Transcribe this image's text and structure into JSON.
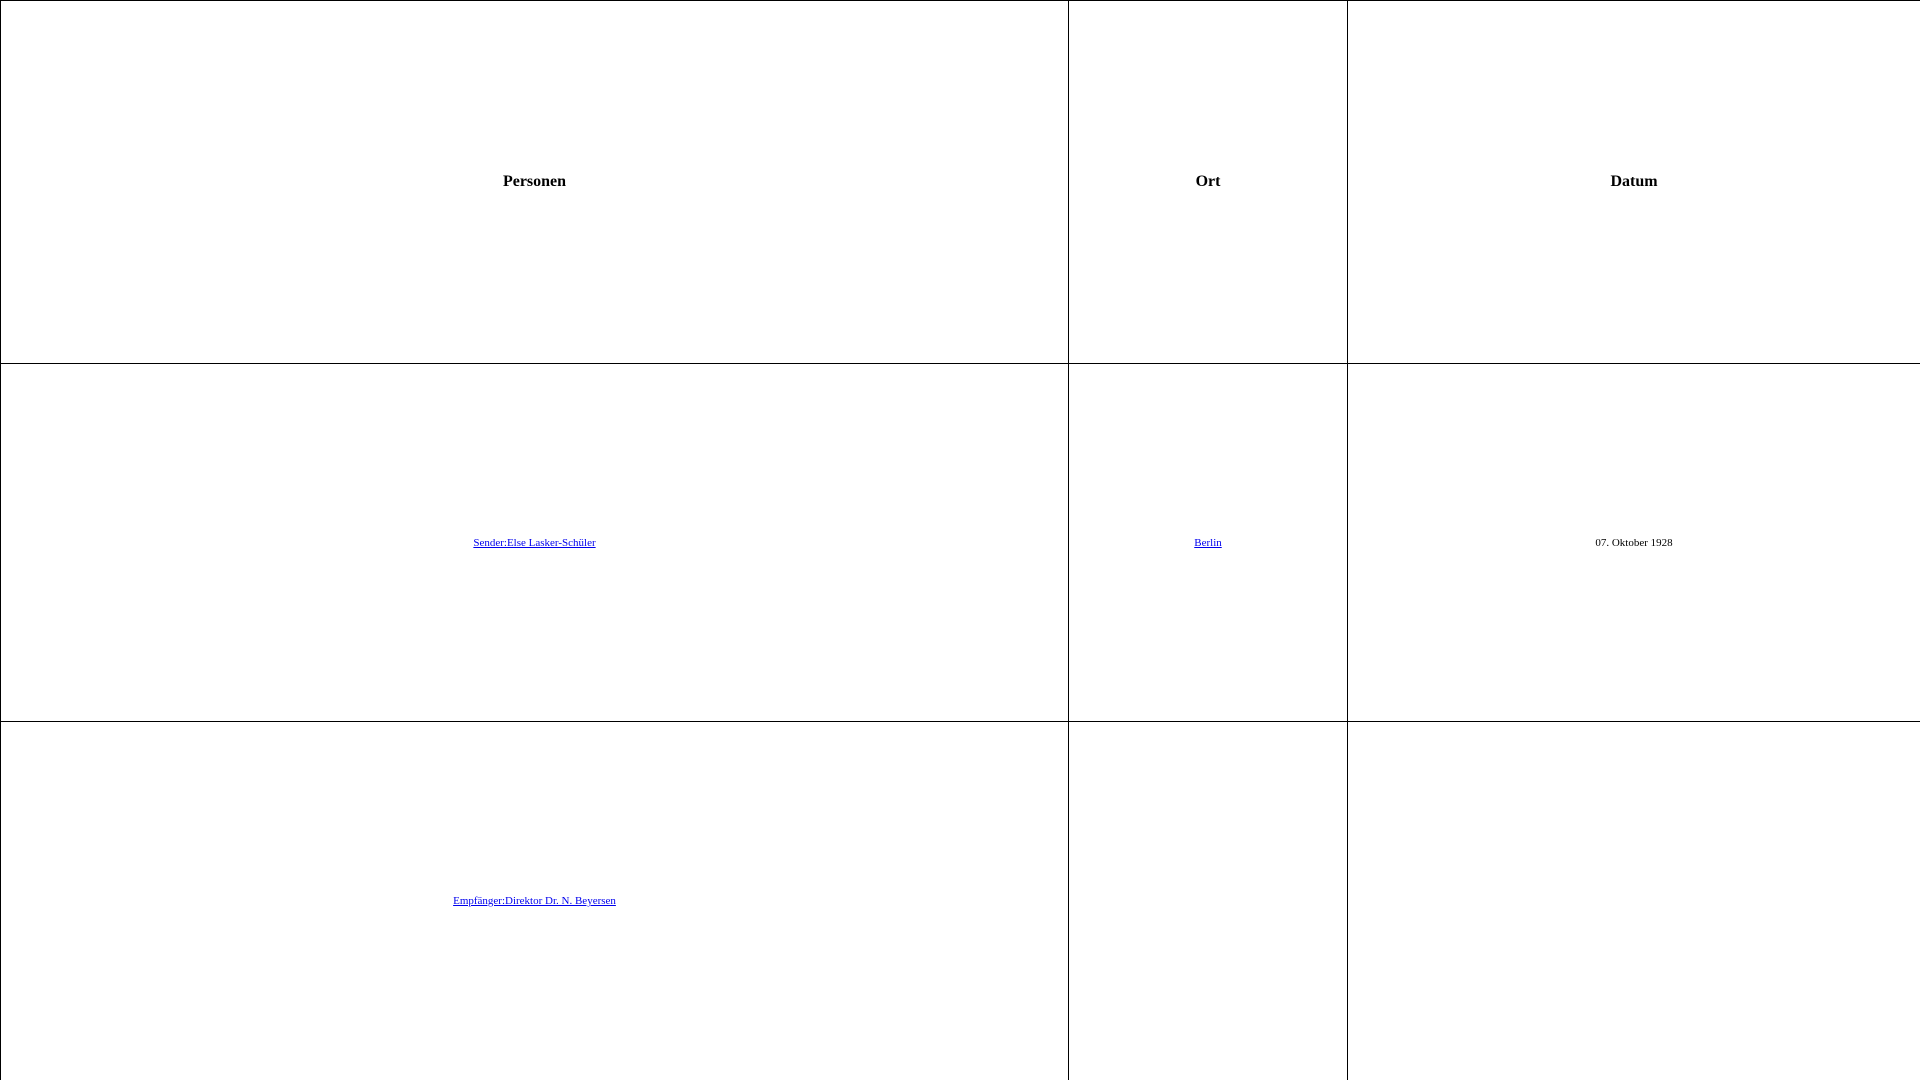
{
  "table": {
    "headers": {
      "personen": "Personen",
      "ort": "Ort",
      "datum": "Datum"
    },
    "rows": [
      {
        "person": "Sender:Else Lasker-Schüler",
        "ort": "Berlin",
        "datum": "07. Oktober 1928"
      },
      {
        "person": "Empfänger:Direktor Dr. N. Beyersen",
        "ort": "",
        "datum": ""
      }
    ]
  },
  "colors": {
    "link": "#0000ee",
    "border": "#000000",
    "background": "#ffffff"
  }
}
